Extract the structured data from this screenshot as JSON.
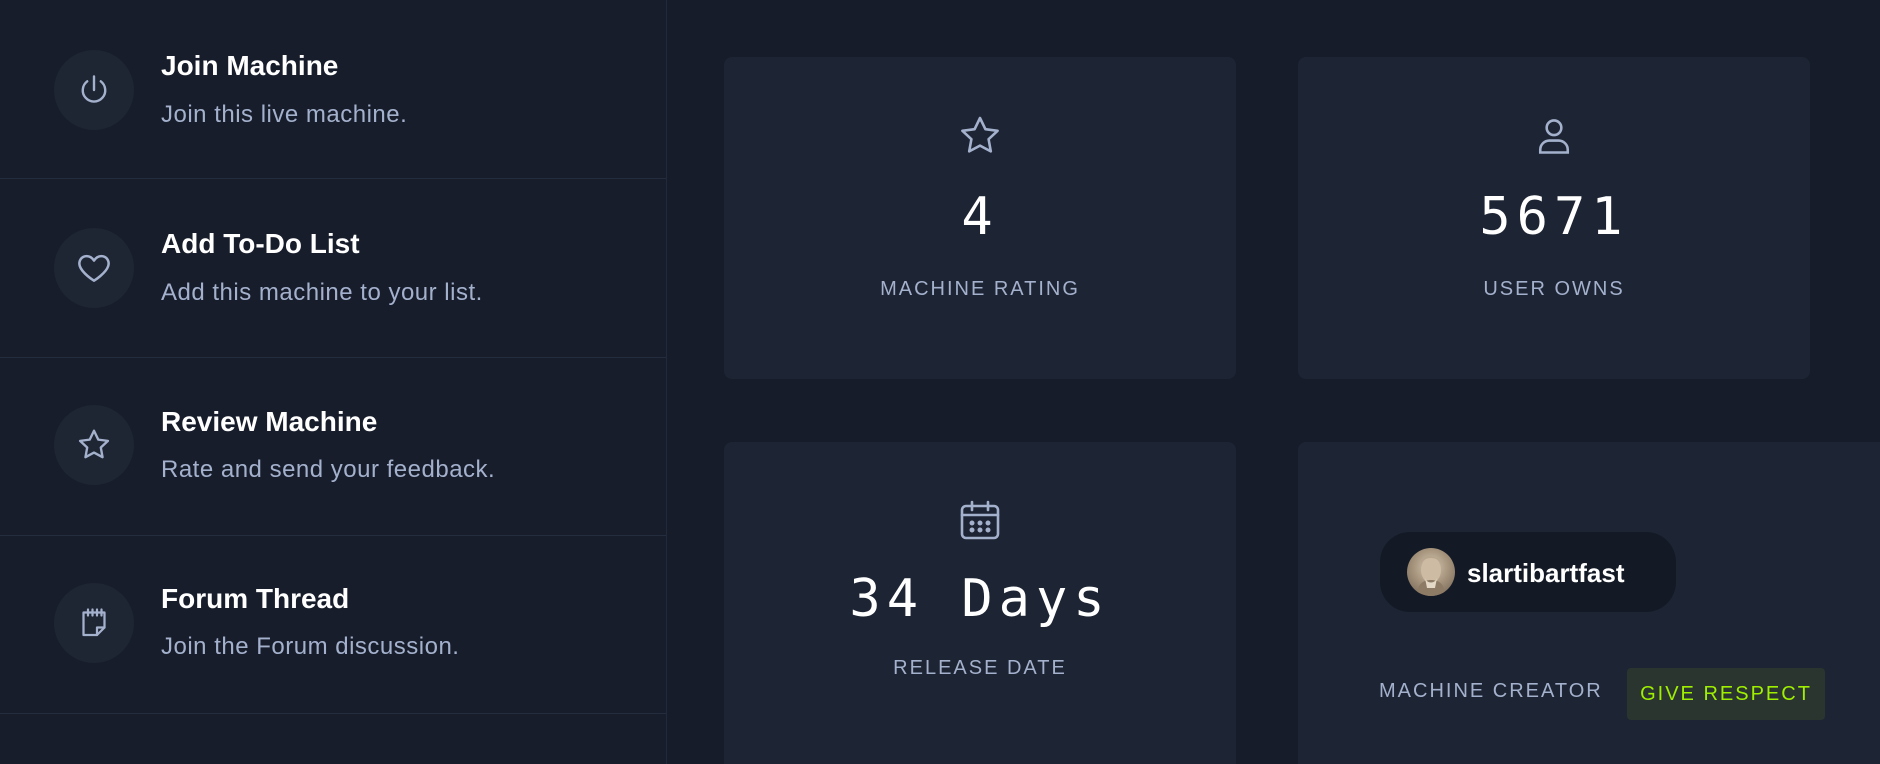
{
  "actions": [
    {
      "title": "Join Machine",
      "desc": "Join this live machine.",
      "icon": "power-icon"
    },
    {
      "title": "Add To-Do List",
      "desc": "Add this machine to your list.",
      "icon": "heart-icon"
    },
    {
      "title": "Review Machine",
      "desc": "Rate and send your feedback.",
      "icon": "star-icon"
    },
    {
      "title": "Forum Thread",
      "desc": "Join the Forum discussion.",
      "icon": "notepad-icon"
    }
  ],
  "stats": {
    "rating": {
      "value": "4",
      "label": "MACHINE RATING",
      "icon": "star-icon"
    },
    "owns": {
      "value": "5671",
      "label": "USER OWNS",
      "icon": "user-icon"
    },
    "release": {
      "value": "34 Days",
      "label": "RELEASE DATE",
      "icon": "calendar-icon"
    }
  },
  "creator": {
    "name": "slartibartfast",
    "label": "MACHINE CREATOR",
    "respect_label": "GIVE RESPECT"
  },
  "colors": {
    "background": "#161c2a",
    "card": "#1d2433",
    "accent": "#9fef00",
    "muted_text": "#a4b1cd"
  }
}
